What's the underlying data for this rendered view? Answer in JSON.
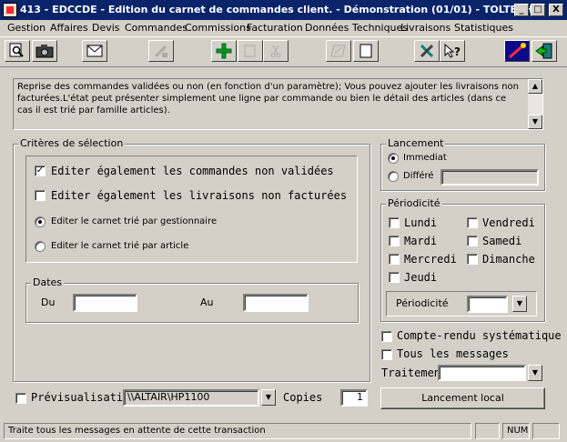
{
  "window": {
    "title": "413 - EDCCDE - Edition du carnet de commandes client. - Démonstration (01/01) - TOLTECH",
    "minimize": "_",
    "maximize": "□",
    "close": "X"
  },
  "menu": [
    "Gestion",
    "Affaires",
    "Devis",
    "Commandes",
    "Commissions",
    "Facturation",
    "Données Techniques",
    "Livraisons",
    "Statistiques"
  ],
  "toolbar": {
    "icons": [
      "search-icon",
      "camera-icon",
      "mail-icon",
      "edit-icon",
      "add-icon",
      "copy-icon",
      "cut-icon",
      "print-preview-icon",
      "new-document-icon",
      "tools-icon",
      "help-icon",
      "launch-icon",
      "exit-door-icon"
    ]
  },
  "memo": {
    "text": "Reprise des commandes validées ou non (en fonction d'un paramètre); Vous pouvez ajouter les livraisons non facturées.L'état peut présenter simplement une ligne par commande ou bien le détail des articles (dans ce cas il est trié par famille articles)."
  },
  "criteria": {
    "title": "Critères de sélection",
    "check_unvalidated": {
      "label": "Editer également les commandes non validées",
      "checked": true
    },
    "check_unbilled": {
      "label": "Editer également les livraisons non facturées",
      "checked": false
    },
    "radio_manager": {
      "label": "Editer le carnet trié par gestionnaire",
      "selected": true
    },
    "radio_article": {
      "label": "Editer le carnet trié par article",
      "selected": false
    }
  },
  "dates": {
    "title": "Dates",
    "from_label": "Du",
    "from_value": "",
    "to_label": "Au",
    "to_value": ""
  },
  "launch": {
    "title": "Lancement",
    "immediate": "Immediat",
    "deferred": "Différé",
    "deferred_value": ""
  },
  "periodicity": {
    "title": "Périodicité",
    "days": [
      "Lundi",
      "Mardi",
      "Mercredi",
      "Jeudi",
      "Vendredi",
      "Samedi",
      "Dimanche"
    ],
    "field_label": "Périodicité",
    "field_value": ""
  },
  "options": {
    "report": "Compte-rendu systématique",
    "all_messages": "Tous les messages",
    "treatment_label": "Traitement",
    "treatment_value": ""
  },
  "bottom": {
    "preview_label": "Prévisualisation",
    "printer": "\\\\ALTAIR\\HP1100",
    "copies_label": "Copies",
    "copies_value": "1",
    "local_launch": "Lancement local"
  },
  "status": {
    "message": "Traite tous les messages en attente de cette transaction",
    "num": "NUM"
  },
  "colors": {
    "titlebar": "#0a246a",
    "face": "#d4d0c8"
  }
}
